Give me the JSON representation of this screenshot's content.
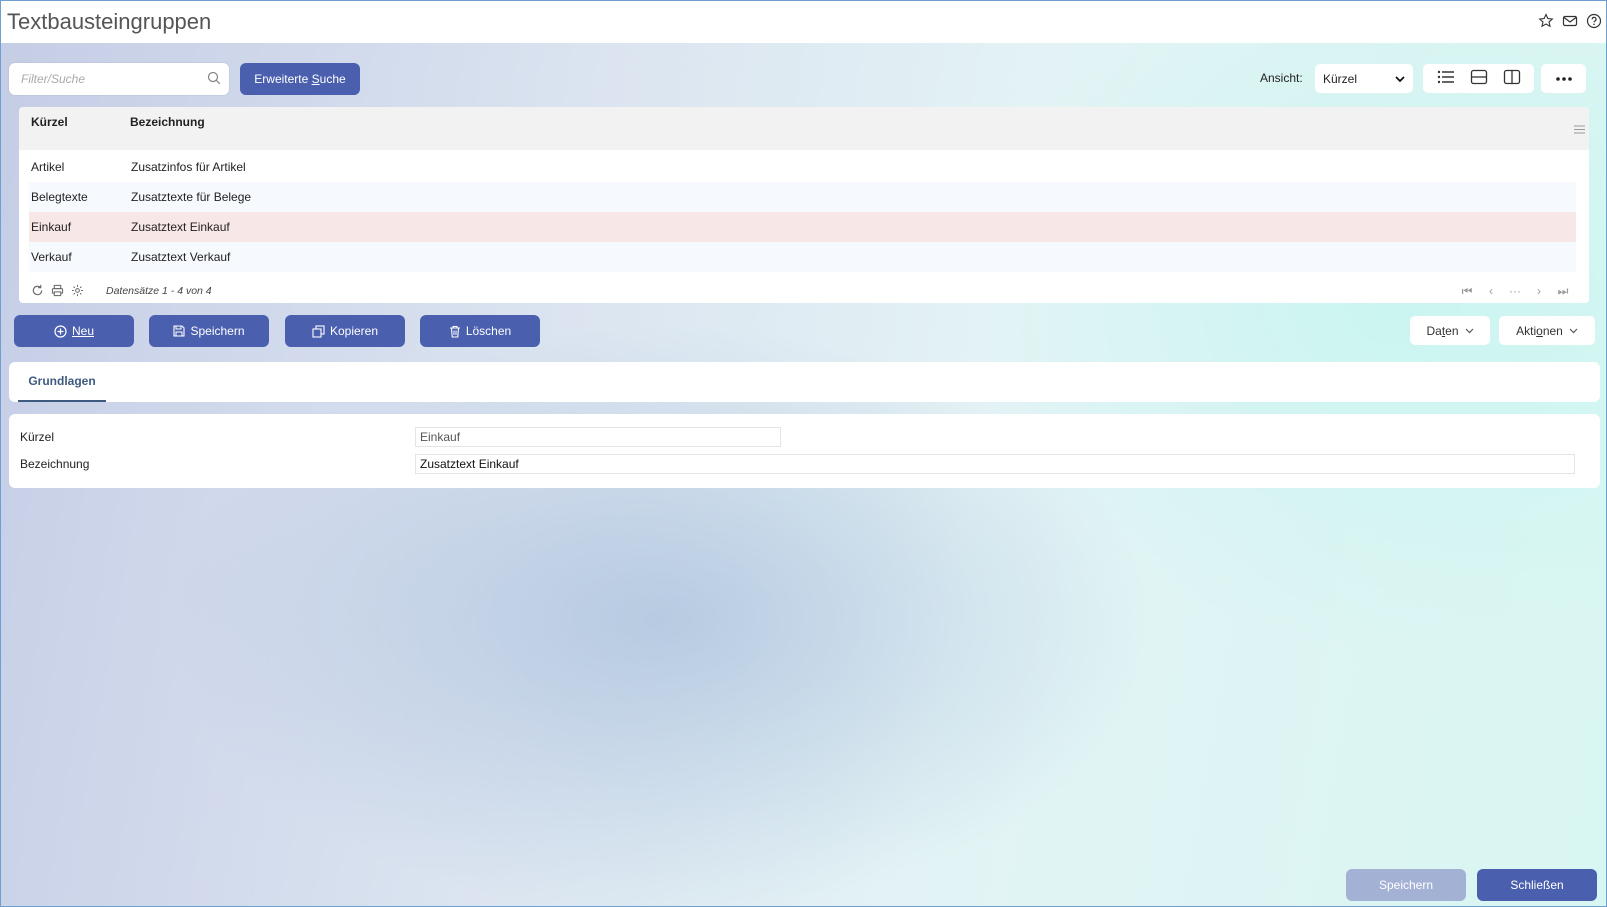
{
  "header": {
    "title": "Textbausteingruppen"
  },
  "icons": {
    "favorite": "star-icon",
    "mail": "mail-icon",
    "help": "help-icon"
  },
  "colors": {
    "primary": "#4a5fae",
    "selected_row": "#f8e7e7",
    "tab_accent": "#3e5a80",
    "disabled_button": "#a3b1d4"
  },
  "search": {
    "placeholder": "Filter/Suche",
    "value": ""
  },
  "advanced_search": {
    "label_pre": "Erweiterte ",
    "label_key": "S",
    "label_post": "uche"
  },
  "view": {
    "label": "Ansicht:",
    "selected": "Kürzel"
  },
  "grid": {
    "columns": [
      "Kürzel",
      "Bezeichnung"
    ],
    "rows": [
      {
        "kurzel": "Artikel",
        "bezeichnung": "Zusatzinfos für Artikel"
      },
      {
        "kurzel": "Belegtexte",
        "bezeichnung": "Zusatztexte für Belege"
      },
      {
        "kurzel": "Einkauf",
        "bezeichnung": "Zusatztext Einkauf"
      },
      {
        "kurzel": "Verkauf",
        "bezeichnung": "Zusatztext Verkauf"
      }
    ],
    "selected_row": 2,
    "records_info": "Datensätze 1 - 4 von 4",
    "pager_dots": "···"
  },
  "actions": {
    "new": "Neu",
    "save": "Speichern",
    "copy": "Kopieren",
    "delete": "Löschen",
    "data_pre": "Da",
    "data_key": "t",
    "data_post": "en",
    "actions_pre": "Akti",
    "actions_key": "o",
    "actions_post": "nen"
  },
  "tabs": [
    {
      "label": "Grundlagen",
      "active": true
    }
  ],
  "form": {
    "kurzel_label": "Kürzel",
    "kurzel_value": "Einkauf",
    "bezeichnung_label": "Bezeichnung",
    "bezeichnung_value": "Zusatztext Einkauf"
  },
  "footer": {
    "save": "Speichern",
    "close": "Schließen"
  }
}
